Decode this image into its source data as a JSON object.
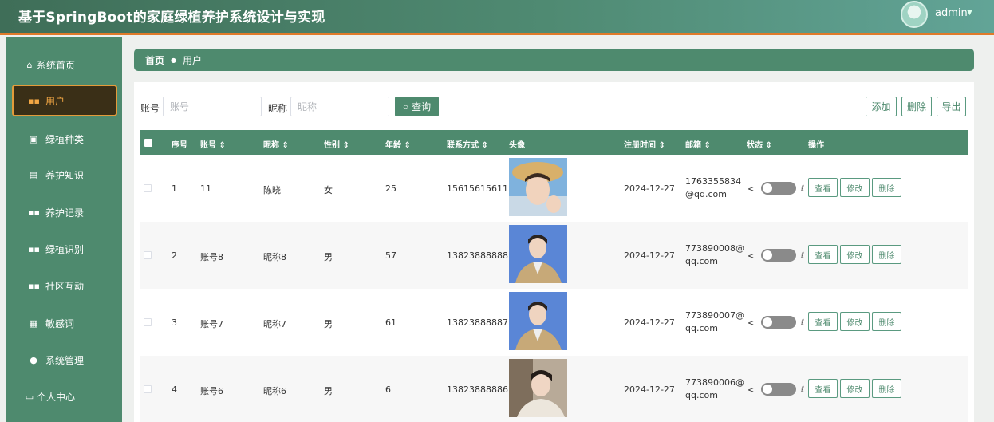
{
  "app": {
    "title": "基于SpringBoot的家庭绿植养护系统设计与实现",
    "user": "admin"
  },
  "sidebar": {
    "items": [
      {
        "label": "系统首页",
        "icon": "home-icon"
      },
      {
        "label": "用户",
        "icon": "grid-icon",
        "active": true
      },
      {
        "label": "绿植种类",
        "icon": "clipboard-icon"
      },
      {
        "label": "养护知识",
        "icon": "document-icon"
      },
      {
        "label": "养护记录",
        "icon": "grid-icon"
      },
      {
        "label": "绿植识别",
        "icon": "grid-icon"
      },
      {
        "label": "社区互动",
        "icon": "grid-icon"
      },
      {
        "label": "敏感词",
        "icon": "list-icon"
      },
      {
        "label": "系统管理",
        "icon": "user-icon"
      },
      {
        "label": "个人中心",
        "icon": "card-icon"
      }
    ]
  },
  "breadcrumb": {
    "home": "首页",
    "current": "用户"
  },
  "search": {
    "account_label": "账号",
    "account_placeholder": "账号",
    "nickname_label": "昵称",
    "nickname_placeholder": "昵称",
    "query_label": "查询"
  },
  "toolbar": {
    "add": "添加",
    "delete": "删除",
    "export": "导出"
  },
  "table": {
    "headers": {
      "index": "序号",
      "account": "账号",
      "nickname": "昵称",
      "gender": "性别",
      "age": "年龄",
      "phone": "联系方式",
      "avatar": "头像",
      "registered": "注册时间",
      "email": "邮箱",
      "status": "状态",
      "actions": "操作"
    },
    "sort_glyph": "⇕",
    "rows": [
      {
        "index": "1",
        "account": "11",
        "nickname": "陈晓",
        "gender": "女",
        "age": "25",
        "phone": "15615615611",
        "registered": "2024-12-27",
        "email": "1763355834@qq.com",
        "status_on": false
      },
      {
        "index": "2",
        "account": "账号8",
        "nickname": "昵称8",
        "gender": "男",
        "age": "57",
        "phone": "13823888888",
        "registered": "2024-12-27",
        "email": "773890008@qq.com",
        "status_on": false
      },
      {
        "index": "3",
        "account": "账号7",
        "nickname": "昵称7",
        "gender": "男",
        "age": "61",
        "phone": "13823888887",
        "registered": "2024-12-27",
        "email": "773890007@qq.com",
        "status_on": false
      },
      {
        "index": "4",
        "account": "账号6",
        "nickname": "昵称6",
        "gender": "男",
        "age": "6",
        "phone": "13823888886",
        "registered": "2024-12-27",
        "email": "773890006@qq.com",
        "status_on": false
      }
    ],
    "row_actions": {
      "view": "查看",
      "edit": "修改",
      "delete": "删除"
    }
  },
  "colors": {
    "primary": "#4e8a6e",
    "active_border": "#e39b3a",
    "active_bg": "#3a2f17",
    "header_accent": "#e07a2a"
  }
}
